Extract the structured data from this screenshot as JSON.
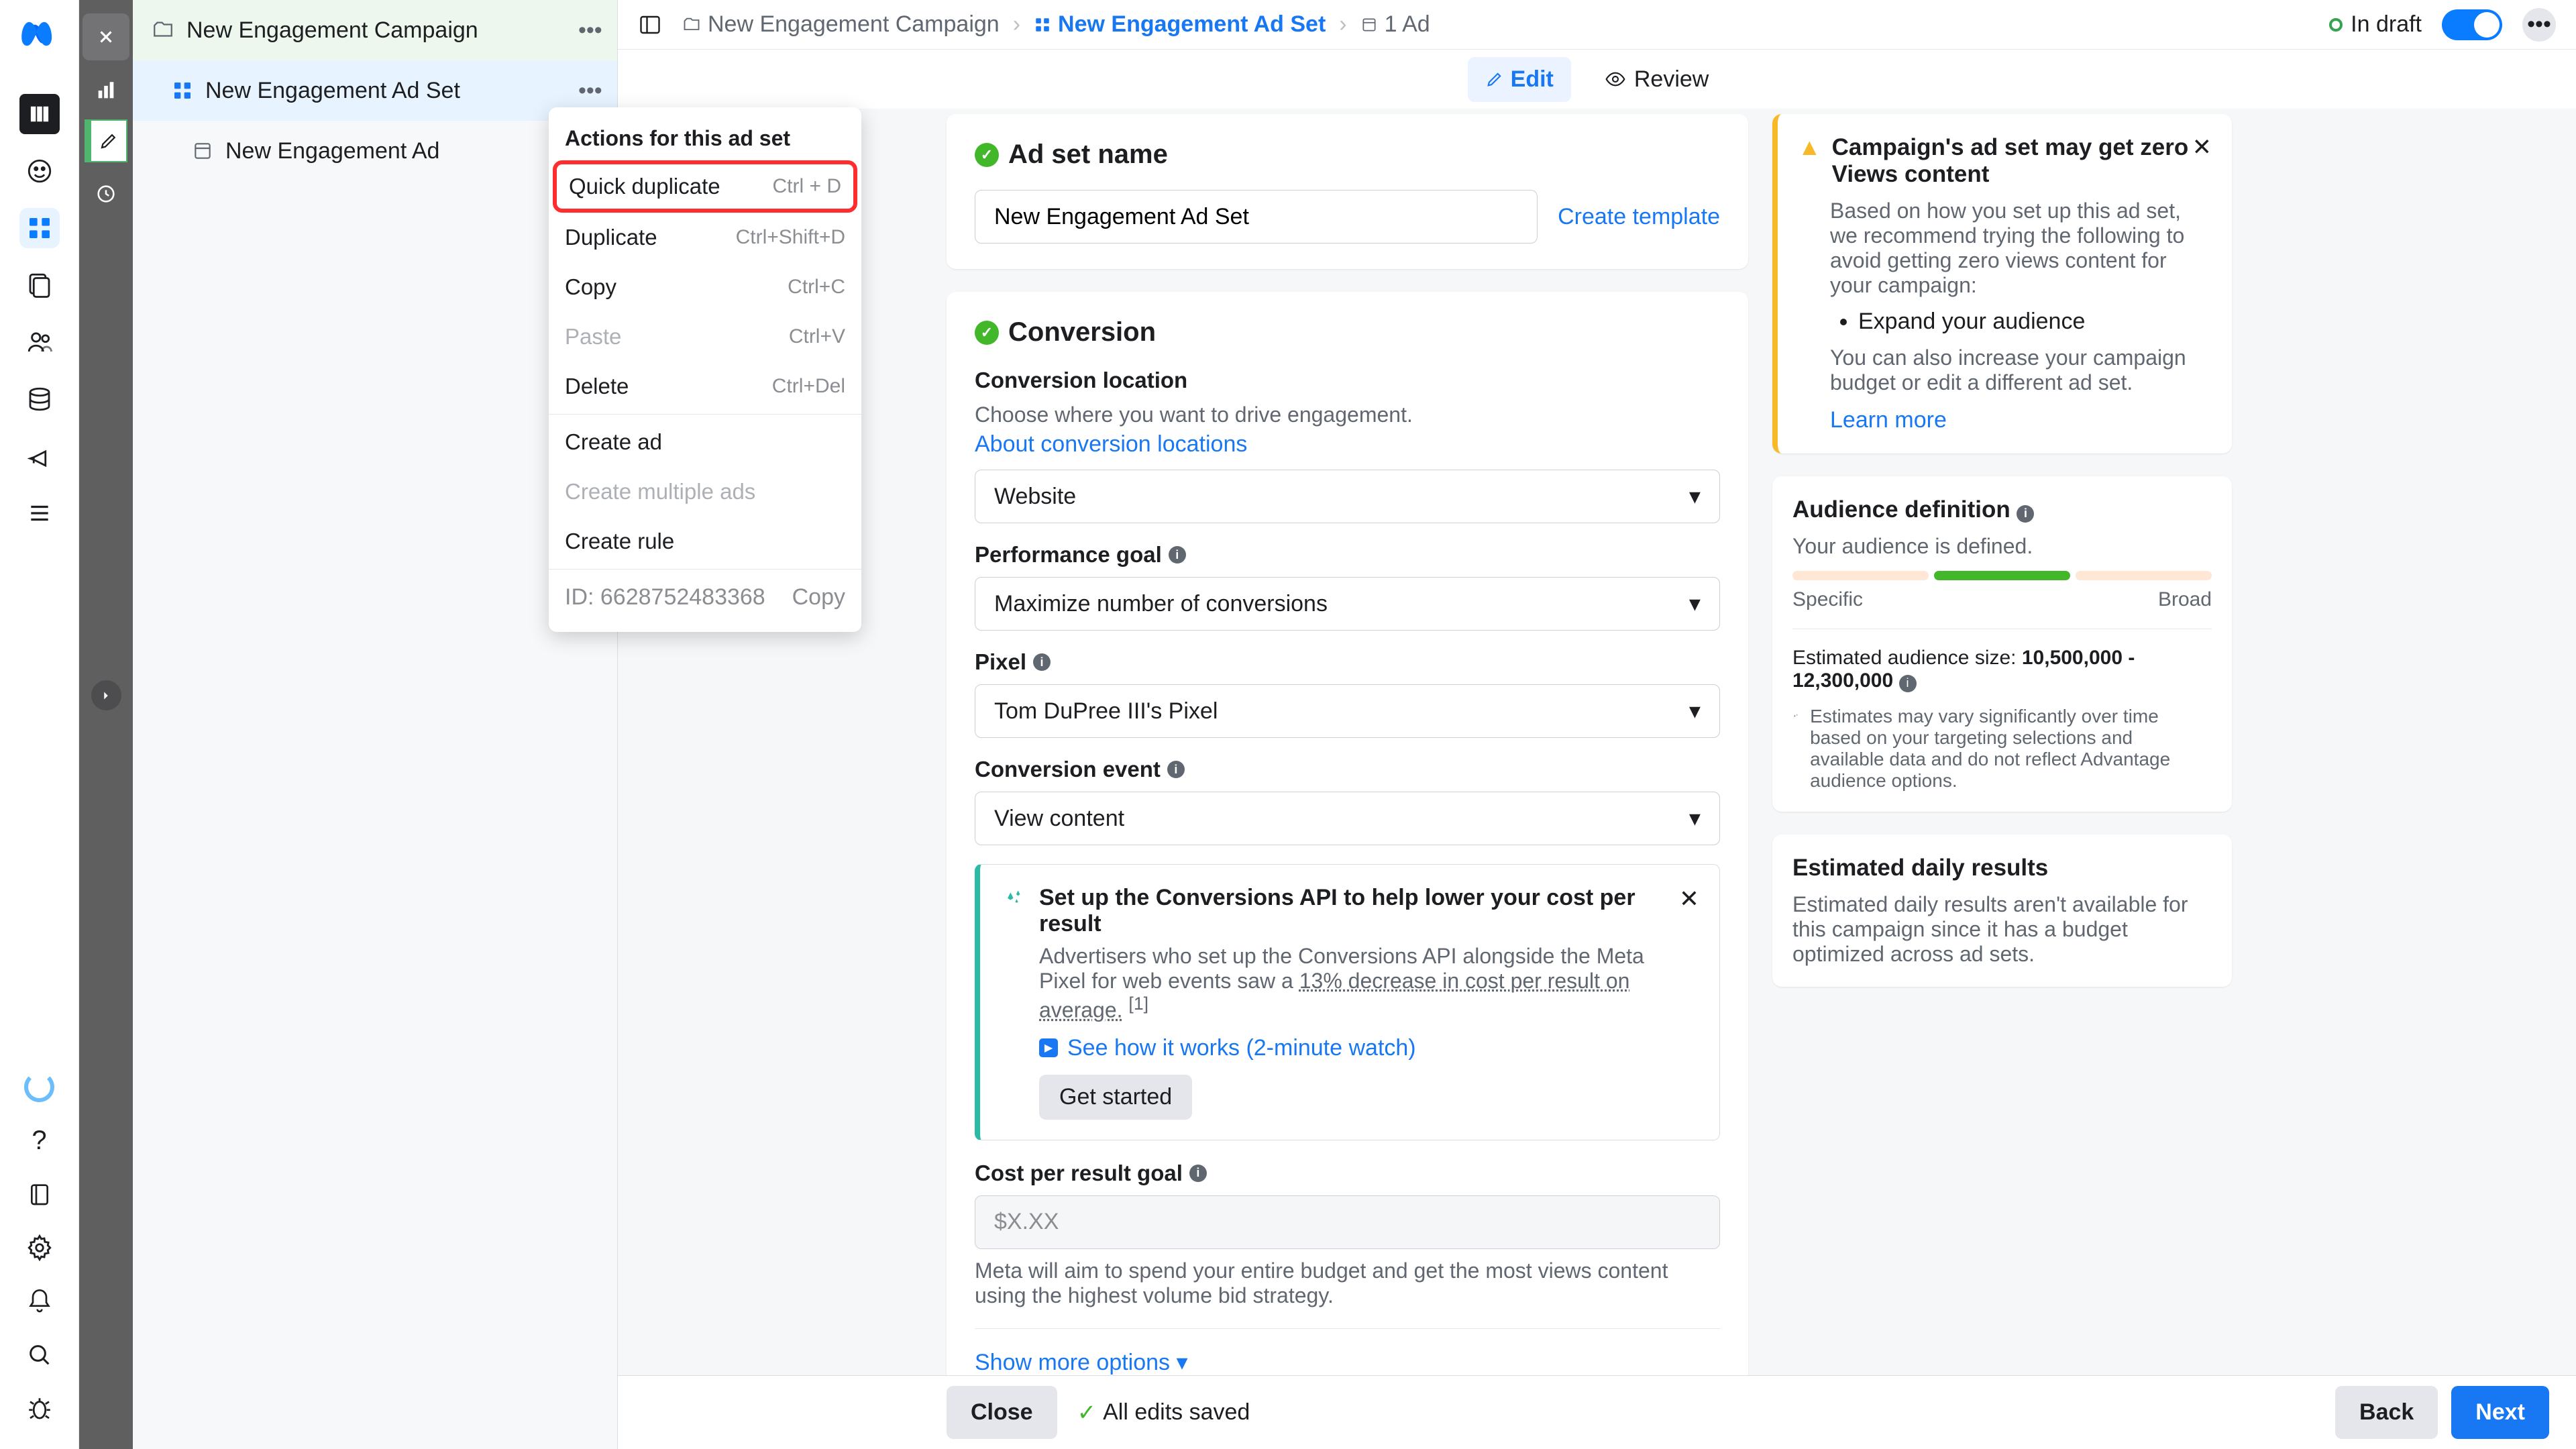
{
  "leftNav": {
    "campaign": "New Engagement Campaign",
    "adset": "New Engagement Ad Set",
    "ad": "New Engagement Ad"
  },
  "breadcrumbs": {
    "campaign": "New Engagement Campaign",
    "adset": "New Engagement Ad Set",
    "ad": "1 Ad"
  },
  "topStatus": {
    "label": "In draft"
  },
  "tabs": {
    "edit": "Edit",
    "review": "Review"
  },
  "contextMenu": {
    "header": "Actions for this ad set",
    "quickDup": "Quick duplicate",
    "quickDupSc": "Ctrl + D",
    "dup": "Duplicate",
    "dupSc": "Ctrl+Shift+D",
    "copy": "Copy",
    "copySc": "Ctrl+C",
    "paste": "Paste",
    "pasteSc": "Ctrl+V",
    "del": "Delete",
    "delSc": "Ctrl+Del",
    "createAd": "Create ad",
    "createMulti": "Create multiple ads",
    "createRule": "Create rule",
    "idLabel": "ID: 6628752483368",
    "copyId": "Copy"
  },
  "adsetCard": {
    "title": "Ad set name",
    "value": "New Engagement Ad Set",
    "createTemplate": "Create template"
  },
  "conversion": {
    "title": "Conversion",
    "locLabel": "Conversion location",
    "locDesc": "Choose where you want to drive engagement.",
    "locLink": "About conversion locations",
    "locValue": "Website",
    "perfLabel": "Performance goal",
    "perfValue": "Maximize number of conversions",
    "pixelLabel": "Pixel",
    "pixelValue": "Tom DuPree III's Pixel",
    "eventLabel": "Conversion event",
    "eventValue": "View content",
    "api": {
      "title": "Set up the Conversions API to help lower your cost per result",
      "body1": "Advertisers who set up the Conversions API alongside the Meta Pixel for web events saw a ",
      "body2": "13% decrease in cost per result on average.",
      "sup": "[1]",
      "watch": "See how it works (2-minute watch)",
      "get": "Get started"
    },
    "costLabel": "Cost per result goal",
    "costPlaceholder": "$X.XX",
    "costHelp": "Meta will aim to spend your entire budget and get the most views content using the highest volume bid strategy.",
    "showMore": "Show more options"
  },
  "warn": {
    "title": "Campaign's ad set may get zero Views content",
    "body": "Based on how you set up this ad set, we recommend trying the following to avoid getting zero views content for your campaign:",
    "bullet": "Expand your audience",
    "body2": "You can also increase your campaign budget or edit a different ad set.",
    "learn": "Learn more"
  },
  "audience": {
    "title": "Audience definition",
    "defined": "Your audience is defined.",
    "specific": "Specific",
    "broad": "Broad",
    "estLabel": "Estimated audience size:",
    "estValue": "10,500,000 - 12,300,000",
    "disclaimer": "Estimates may vary significantly over time based on your targeting selections and available data and do not reflect Advantage audience options."
  },
  "daily": {
    "title": "Estimated daily results",
    "body": "Estimated daily results aren't available for this campaign since it has a budget optimized across ad sets."
  },
  "footer": {
    "close": "Close",
    "saved": "All edits saved",
    "back": "Back",
    "next": "Next"
  }
}
